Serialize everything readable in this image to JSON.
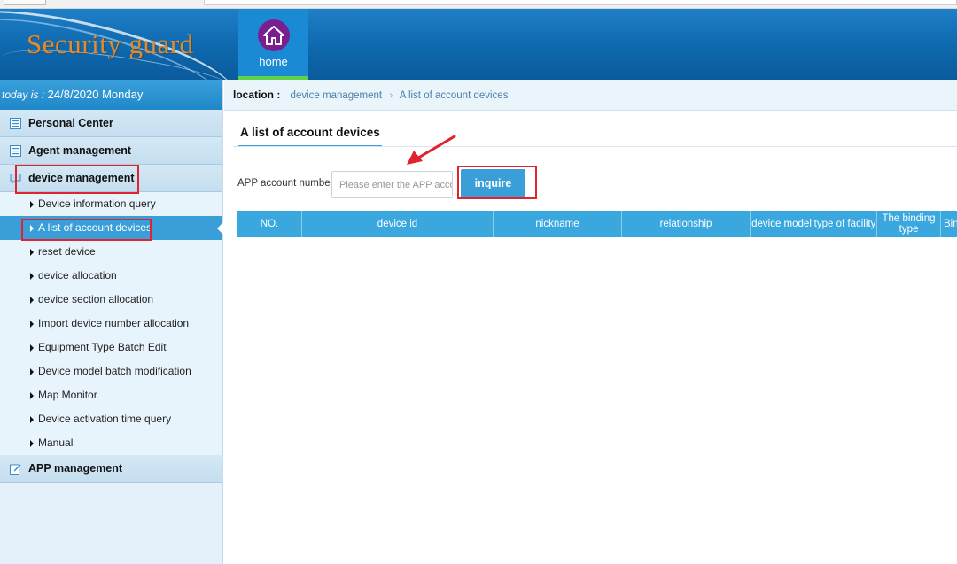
{
  "header": {
    "logo": "Security guard",
    "home_label": "home"
  },
  "sidebar": {
    "date_prefix": "today is :",
    "date_value": "24/8/2020 Monday",
    "groups": [
      {
        "label": "Personal Center",
        "icon": "list-icon"
      },
      {
        "label": "Agent management",
        "icon": "list-icon"
      },
      {
        "label": "device management",
        "icon": "chat-icon"
      },
      {
        "label": "APP management",
        "icon": "edit-icon"
      }
    ],
    "device_items": [
      "Device information query",
      "A list of account devices",
      "reset device",
      "device allocation",
      "device section allocation",
      "Import device number allocation",
      "Equipment Type Batch Edit",
      "Device model batch modification",
      "Map Monitor",
      "Device activation time query",
      "Manual"
    ],
    "active_item": "A list of account devices"
  },
  "breadcrumb": {
    "label": "location :",
    "items": [
      "device management",
      "A list of account devices"
    ]
  },
  "page": {
    "title": "A list of account devices",
    "account_label": "APP account number:",
    "account_placeholder": "Please enter the APP account",
    "account_value": "",
    "inquire_label": "inquire"
  },
  "table": {
    "columns": [
      "NO.",
      "device id",
      "nickname",
      "relationship",
      "device model",
      "type of facility",
      "The binding type",
      "Binding"
    ],
    "rows": []
  },
  "colors": {
    "header_blue": "#0e68ad",
    "accent_blue": "#3a9fd8",
    "logo_orange": "#e58a2b",
    "annotation_red": "#e0232d",
    "home_active_green": "#5fd14a"
  }
}
